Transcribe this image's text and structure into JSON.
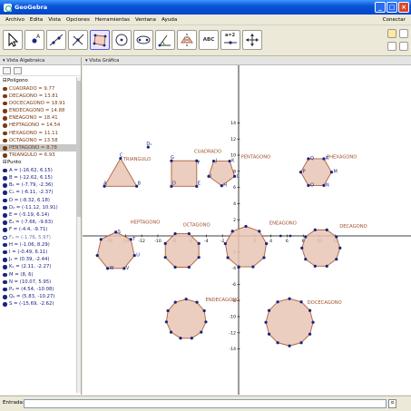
{
  "window": {
    "title": "GeoGebra"
  },
  "menu": [
    "Archivo",
    "Edita",
    "Vista",
    "Opciones",
    "Herramientas",
    "Ventana",
    "Ayuda"
  ],
  "connect_label": "Conectar",
  "toolbar": {
    "text_tool_label": "ABC",
    "slider_tool_label": "a=2"
  },
  "algebra": {
    "title": "Vista Algebraica",
    "polygon_group": "Polígono",
    "polygons": [
      "CUADRADO = 9.77",
      "DECAGONO = 13.81",
      "DOCECAGONO = 18.91",
      "ENDECAGONO = 14.88",
      "ENEAGONO = 18.41",
      "HEPTAGONO = 14.54",
      "HEXAGONO = 11.11",
      "OCTAGONO = 13.58",
      "PENTAGONO = 8.78",
      "TRIANGULO = 6.93"
    ],
    "point_group": "Punto",
    "points": [
      "A = (-16.62, 6.15)",
      "B = (-12.62, 6.15)",
      "B₁ = (-7.79, -2.36)",
      "C₁ = (-6.11, -2.37)",
      "D = (-8.32, 6.18)",
      "D₂ = (-11.12, 10.91)",
      "E = (-5.19, 6.14)",
      "E₂ = (-7.66, -9.63)",
      "F = (-4.4, -9.71)",
      "F₂ = (-1.76, 5.97)",
      "H = (-1.06, 8.29)",
      "I = (-0.49, 6.11)",
      "J₁ = (0.39, -2.44)",
      "K₁ = (2.11, -2.27)",
      "M = (8, 6)",
      "N = (10.07, 5.95)",
      "P₂ = (4.54, -10.08)",
      "Q₂ = (5.83, -10.27)",
      "S = (-15.69, -2.62)"
    ]
  },
  "graphics": {
    "title": "Vista Gráfica",
    "x_tick_labels": [
      "-16",
      "-14",
      "-12",
      "-10",
      "-8",
      "-6",
      "-4",
      "-2",
      "2",
      "4",
      "6",
      "8",
      "10",
      "12"
    ],
    "y_tick_labels": [
      "14",
      "12",
      "10",
      "8",
      "6",
      "4",
      "2",
      "-2",
      "-4",
      "-6",
      "-8",
      "-10",
      "-12",
      "-14"
    ],
    "shape_labels": {
      "triangle": "TRIANGULO",
      "square": "CUADRADO",
      "pentagon": "PENTAGONO",
      "hexagon": "PHEXAGONO",
      "heptagon": "HEPTAGONO",
      "octagon": "OCTAGONO",
      "nonagon": "ENEAGONO",
      "decagon": "DECAGONO",
      "hendecagon": "ENDECAGONO",
      "dodecagon": "DOCECAGONO"
    },
    "vertex_labels": {
      "triangle": [
        "A",
        "B",
        "C"
      ],
      "square": [
        "D",
        "E",
        "F",
        "G"
      ],
      "pentagon": [
        "H",
        "I",
        "J",
        "K",
        "L"
      ],
      "hexagon": [
        "M",
        "N",
        "O",
        "P",
        "Q",
        "R"
      ],
      "heptagon": [
        "S",
        "T",
        "U",
        "V",
        "W"
      ],
      "point_d1": "D₁"
    }
  },
  "input": {
    "label": "Entrada:"
  },
  "colors": {
    "polygon_fill": "#e9c5b5",
    "polygon_edge": "#b05f3c",
    "point": "#1a237e",
    "label": "#a0522d"
  }
}
